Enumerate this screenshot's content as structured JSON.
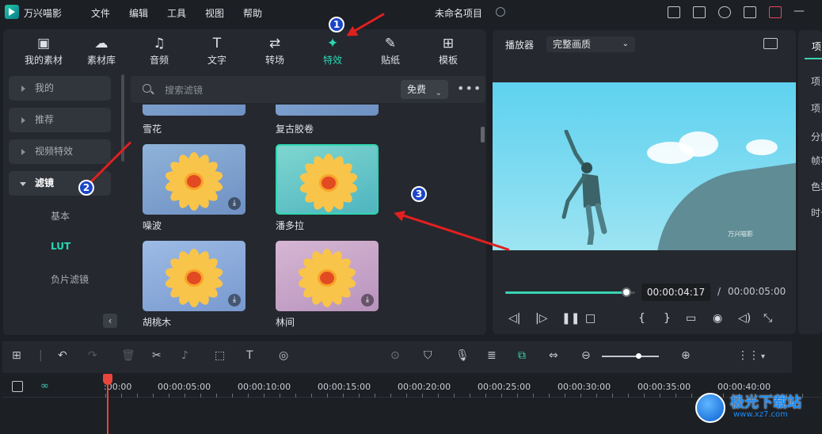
{
  "app": {
    "name": "万兴喵影",
    "project_name": "未命名项目"
  },
  "menu": [
    "文件",
    "编辑",
    "工具",
    "视图",
    "帮助"
  ],
  "media_tabs": [
    {
      "label": "我的素材",
      "icon": "image-icon",
      "active": false
    },
    {
      "label": "素材库",
      "icon": "cloud-icon",
      "active": false
    },
    {
      "label": "音频",
      "icon": "music-note-icon",
      "active": false
    },
    {
      "label": "文字",
      "icon": "text-t-icon",
      "active": false
    },
    {
      "label": "转场",
      "icon": "transition-icon",
      "active": false
    },
    {
      "label": "特效",
      "icon": "sparkle-icon",
      "active": true
    },
    {
      "label": "贴纸",
      "icon": "sticker-icon",
      "active": false
    },
    {
      "label": "模板",
      "icon": "template-grid-icon",
      "active": false
    }
  ],
  "sidebar": {
    "items": [
      {
        "label": "我的",
        "expanded": false
      },
      {
        "label": "推荐",
        "expanded": false
      },
      {
        "label": "视频特效",
        "expanded": false
      },
      {
        "label": "滤镜",
        "expanded": true
      }
    ],
    "sub_items": [
      {
        "label": "基本",
        "active": false
      },
      {
        "label": "LUT",
        "active": true
      },
      {
        "label": "负片滤镜",
        "active": false
      }
    ]
  },
  "search": {
    "placeholder": "搜索滤镜",
    "filter_label": "免费"
  },
  "filters": [
    {
      "label": "雪花"
    },
    {
      "label": "复古胶卷"
    },
    {
      "label": "噪波",
      "tint": "#7fa6d6"
    },
    {
      "label": "潘多拉",
      "tint": "#6fc7c9",
      "selected": true
    },
    {
      "label": "胡桃木",
      "tint": "#93b4e0"
    },
    {
      "label": "林间",
      "tint": "#c8a9c9"
    }
  ],
  "player": {
    "label": "播放器",
    "quality": "完整画质",
    "current_time": "00:00:04:17",
    "separator": "/",
    "total_time": "00:00:05:00",
    "progress": 0.93,
    "watermark": "万兴喵影"
  },
  "right_panel": {
    "tab": "项",
    "items": [
      "项目",
      "项目",
      "分辨",
      "帧率",
      "色彩",
      "时长"
    ]
  },
  "timeline": {
    "ruler_labels": [
      ":00:00",
      "00:00:05:00",
      "00:00:10:00",
      "00:00:15:00",
      "00:00:20:00",
      "00:00:25:00",
      "00:00:30:00",
      "00:00:35:00",
      "00:00:40:00"
    ],
    "zoom_level": 0.6
  },
  "annotations": [
    {
      "number": "1"
    },
    {
      "number": "2"
    },
    {
      "number": "3"
    }
  ],
  "brand_watermark": {
    "title": "极光下载站",
    "url": "www.xz7.com"
  },
  "colors": {
    "accent": "#28d7b3",
    "annotation": "#e02020",
    "badge": "#1b45c8"
  }
}
